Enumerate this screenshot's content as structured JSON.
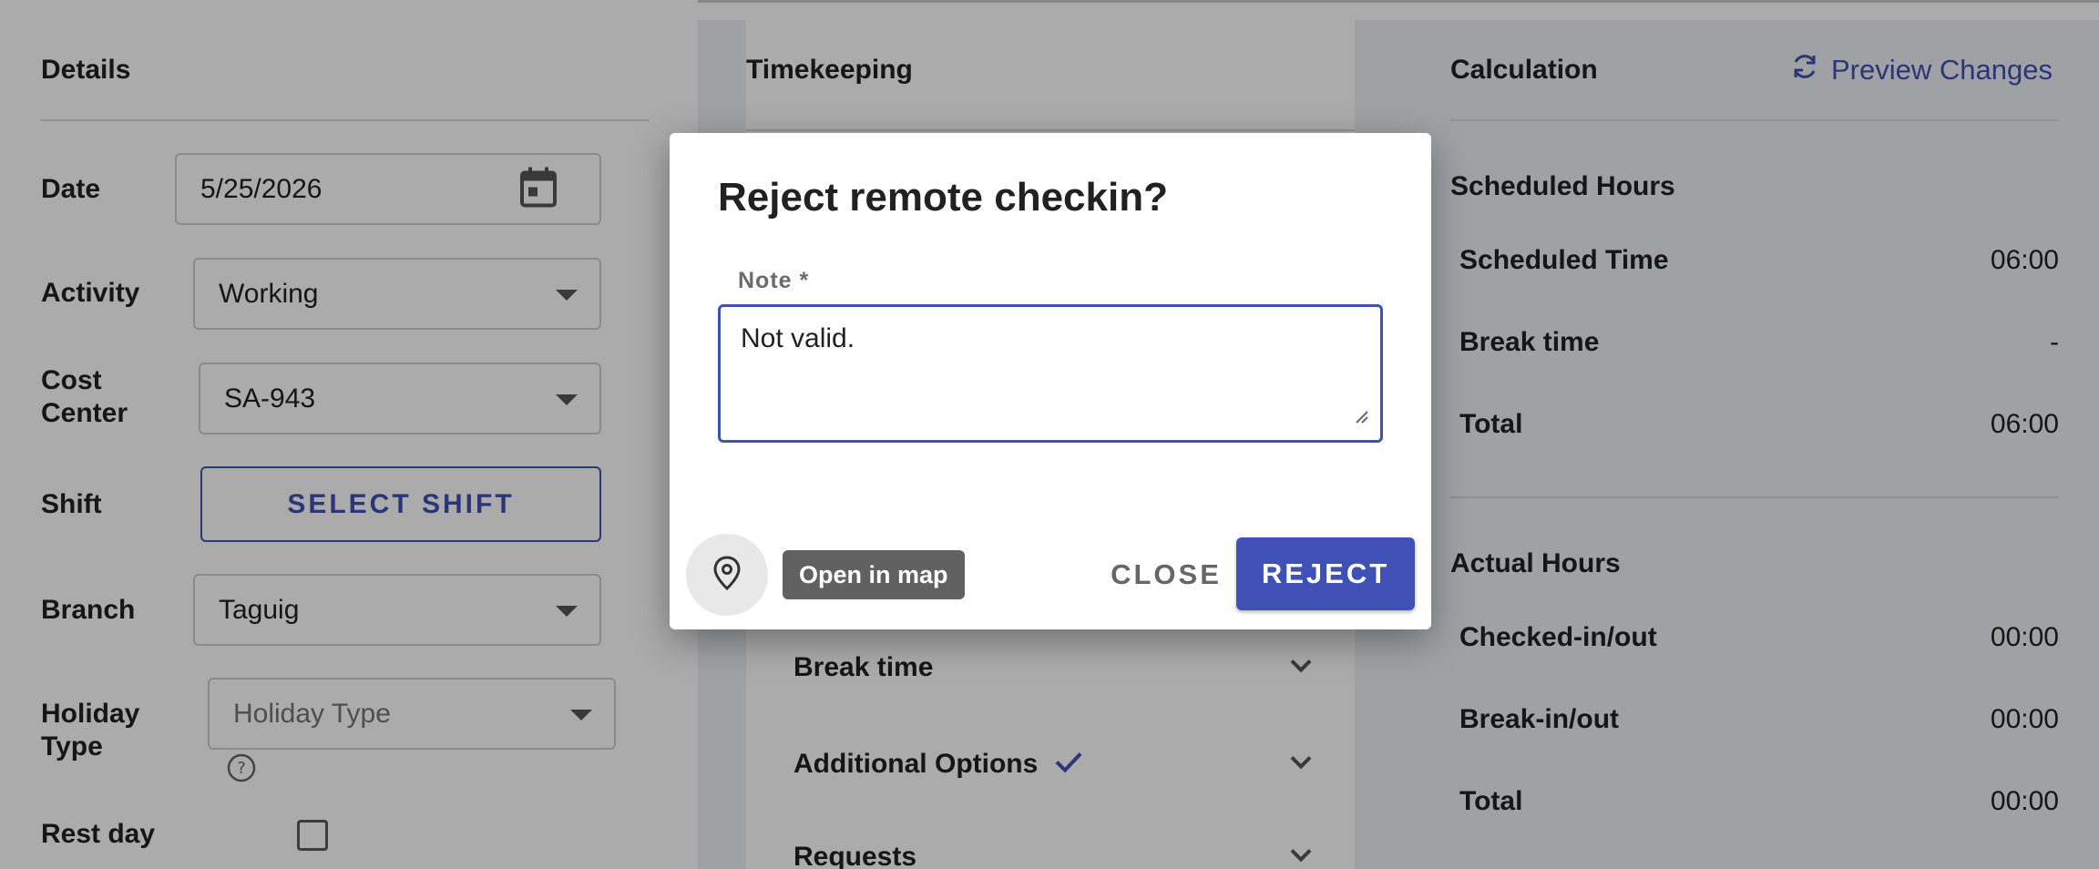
{
  "details": {
    "title": "Details",
    "date_label": "Date",
    "date_value": "5/25/2026",
    "activity_label": "Activity",
    "activity_value": "Working",
    "cost_center_label_1": "Cost",
    "cost_center_label_2": "Center",
    "cost_center_value": "SA-943",
    "shift_label": "Shift",
    "select_shift_button": "SELECT SHIFT",
    "branch_label": "Branch",
    "branch_value": "Taguig",
    "holiday_label_1": "Holiday",
    "holiday_label_2": "Type",
    "holiday_placeholder": "Holiday Type",
    "rest_day_label": "Rest day"
  },
  "timekeeping": {
    "title": "Timekeeping",
    "sections": [
      {
        "label": "Break time"
      },
      {
        "label": "Additional Options"
      },
      {
        "label": "Requests"
      }
    ]
  },
  "calculation": {
    "title": "Calculation",
    "preview_label": "Preview Changes",
    "scheduled": {
      "title": "Scheduled Hours",
      "rows": [
        {
          "label": "Scheduled Time",
          "value": "06:00"
        },
        {
          "label": "Break time",
          "value": "-"
        },
        {
          "label": "Total",
          "value": "06:00"
        }
      ]
    },
    "actual": {
      "title": "Actual Hours",
      "rows": [
        {
          "label": "Checked-in/out",
          "value": "00:00"
        },
        {
          "label": "Break-in/out",
          "value": "00:00"
        },
        {
          "label": "Total",
          "value": "00:00"
        }
      ]
    }
  },
  "dialog": {
    "title": "Reject remote checkin?",
    "note_label": "Note *",
    "note_value": "Not valid.",
    "map_tooltip": "Open in map",
    "close_button": "CLOSE",
    "reject_button": "REJECT"
  },
  "colors": {
    "primary": "#3f51b5",
    "overlay": "rgba(0,0,0,0.33)"
  },
  "icons": {
    "calendar": "calendar-icon",
    "dropdown": "chevron-down-icon",
    "help": "help-circle-icon",
    "refresh": "refresh-icon",
    "check": "check-icon",
    "map_pin": "map-pin-icon",
    "resize": "resize-handle-icon"
  }
}
